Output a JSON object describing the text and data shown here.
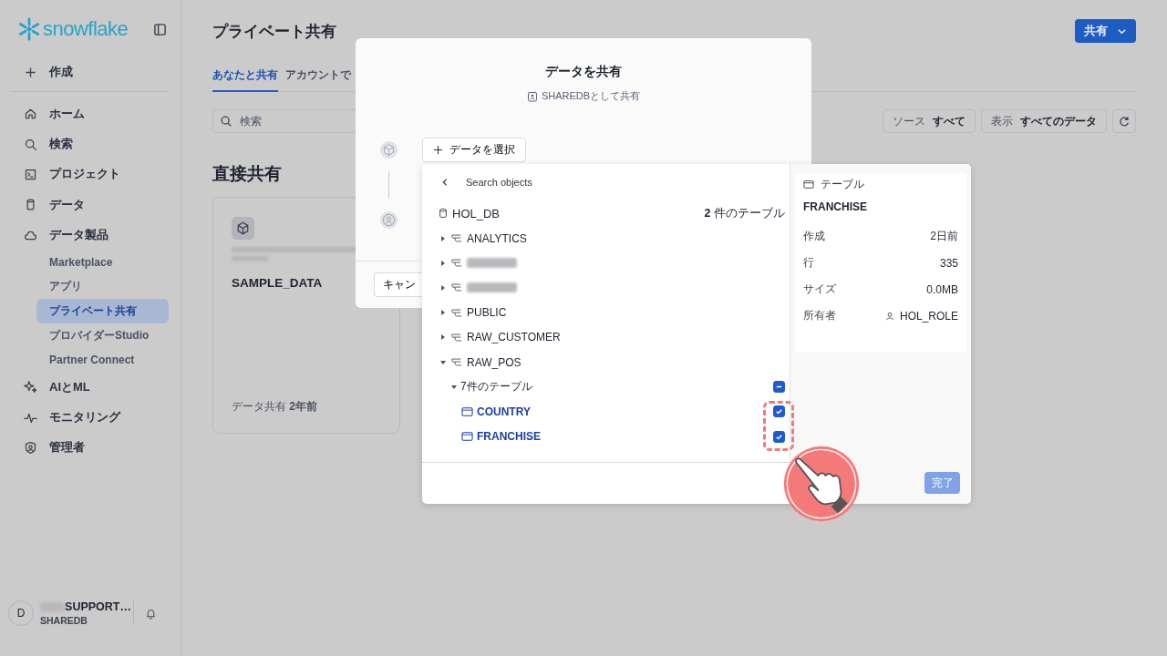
{
  "sidebar": {
    "logo": "snowflake",
    "create": "作成",
    "nav": [
      {
        "label": "ホーム",
        "selected": false
      },
      {
        "label": "検索",
        "selected": false
      },
      {
        "label": "プロジェクト",
        "selected": false
      },
      {
        "label": "データ",
        "selected": false
      },
      {
        "label": "データ製品",
        "selected": false,
        "children": [
          {
            "label": "Marketplace",
            "selected": false
          },
          {
            "label": "アプリ",
            "selected": false
          },
          {
            "label": "プライベート共有",
            "selected": true
          },
          {
            "label": "プロバイダーStudio",
            "selected": false
          },
          {
            "label": "Partner Connect",
            "selected": false
          }
        ]
      },
      {
        "label": "AIとML",
        "selected": false
      },
      {
        "label": "モニタリング",
        "selected": false
      },
      {
        "label": "管理者",
        "selected": false
      }
    ],
    "user": {
      "avatar": "D",
      "name": "SUPPORT…",
      "account": "SHAREDB"
    }
  },
  "page": {
    "title": "プライベート共有",
    "share_button": "共有",
    "tabs": [
      {
        "label": "あなたと共有",
        "selected": true
      },
      {
        "label": "アカウントで",
        "selected": false
      }
    ],
    "search": {
      "placeholder": "検索"
    },
    "filters": [
      {
        "label": "ソース",
        "value": "すべて"
      },
      {
        "label": "表示",
        "value": "すべてのデータ"
      }
    ],
    "section_title": "直接共有",
    "card": {
      "title": "SAMPLE_DATA",
      "footer": "データ共有 **2年前**"
    }
  },
  "modal": {
    "title": "データを共有",
    "subtitle": "SHAREDBとして共有",
    "select_button": "データを選択",
    "cancel_button": "キャン"
  },
  "picker": {
    "search": {
      "placeholder": "Search objects"
    },
    "database": "HOL_DB",
    "count": "**2** 件のテーブル",
    "schemas": [
      {
        "kind": "schema",
        "name": "ANALYTICS",
        "expanded": false
      },
      {
        "kind": "blurred",
        "expanded": false
      },
      {
        "kind": "blurred",
        "expanded": false
      },
      {
        "kind": "schema",
        "name": "PUBLIC",
        "expanded": false
      },
      {
        "kind": "schema",
        "name": "RAW_CUSTOMER",
        "expanded": false
      },
      {
        "kind": "schema",
        "name": "RAW_POS",
        "expanded": true,
        "children": [
          {
            "label": "7件のテーブル",
            "expanded": true,
            "indeterminate": true,
            "children": [
              {
                "name": "COUNTRY",
                "checked": true
              },
              {
                "name": "FRANCHISE",
                "checked": true
              }
            ]
          }
        ]
      }
    ],
    "details": {
      "kind": "テーブル",
      "name": "FRANCHISE",
      "rows": [
        {
          "kind": "text",
          "label": "作成",
          "value": "2日前"
        },
        {
          "kind": "text",
          "label": "行",
          "value": "335"
        },
        {
          "kind": "text",
          "label": "サイズ",
          "value": "0.0MB"
        },
        {
          "kind": "owner",
          "label": "所有者",
          "value": "HOL_ROLE"
        }
      ]
    },
    "done_button": {
      "label": "完了",
      "disabled": true
    }
  }
}
